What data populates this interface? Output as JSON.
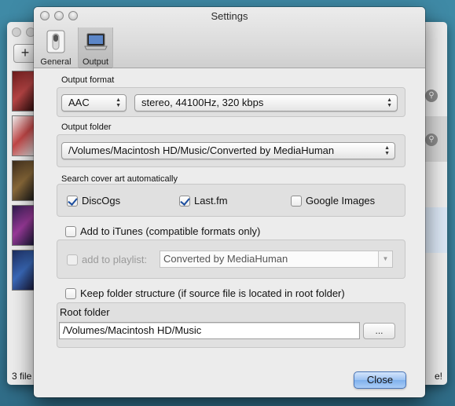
{
  "background_app": {
    "add_label": "+",
    "status_left": "3 file",
    "status_right": "e!"
  },
  "window": {
    "title": "Settings",
    "toolbar": [
      {
        "label": "General",
        "icon": "toggle-switch-icon"
      },
      {
        "label": "Output",
        "icon": "laptop-icon",
        "selected": true
      }
    ]
  },
  "output_format": {
    "label": "Output format",
    "format": "AAC",
    "quality": "stereo, 44100Hz, 320 kbps"
  },
  "output_folder": {
    "label": "Output folder",
    "path": "/Volumes/Macintosh HD/Music/Converted by MediaHuman"
  },
  "cover_art": {
    "label": "Search cover art automatically",
    "sources": [
      {
        "label": "DiscOgs",
        "checked": true
      },
      {
        "label": "Last.fm",
        "checked": true
      },
      {
        "label": "Google Images",
        "checked": false
      }
    ]
  },
  "itunes": {
    "add_label": "Add to iTunes (compatible formats only)",
    "add_checked": false,
    "playlist_label": "add to playlist:",
    "playlist_checked": false,
    "playlist_value": "Converted by MediaHuman"
  },
  "folder_structure": {
    "keep_label": "Keep folder structure (if source file is located in root folder)",
    "keep_checked": false,
    "root_label": "Root folder",
    "root_path": "/Volumes/Macintosh HD/Music",
    "browse_label": "..."
  },
  "close_label": "Close"
}
